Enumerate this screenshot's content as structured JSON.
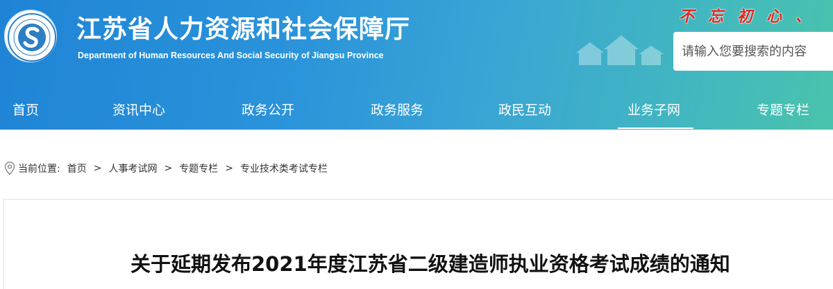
{
  "header": {
    "title_cn": "江苏省人力资源和社会保障厅",
    "title_en": "Department of Human Resources And Social Security of Jiangsu Province",
    "slogan": "不忘初心、",
    "logo_icon": "jiangsu-hrss-emblem-icon",
    "brand_color": "#1f84d6",
    "slogan_color": "#e0261e"
  },
  "search": {
    "placeholder": "请输入您要搜索的内容"
  },
  "nav": {
    "items": [
      {
        "label": "首页"
      },
      {
        "label": "资讯中心"
      },
      {
        "label": "政务公开"
      },
      {
        "label": "政务服务"
      },
      {
        "label": "政民互动"
      },
      {
        "label": "业务子网"
      },
      {
        "label": "专题专栏"
      }
    ],
    "active": "业务子网"
  },
  "breadcrumb": {
    "icon": "location-pin-icon",
    "prefix": "当前位置:",
    "items": [
      "首页",
      "人事考试网",
      "专题专栏",
      "专业技术类考试专栏"
    ],
    "separator": ">"
  },
  "article": {
    "title": "关于延期发布2021年度江苏省二级建造师执业资格考试成绩的通知"
  }
}
